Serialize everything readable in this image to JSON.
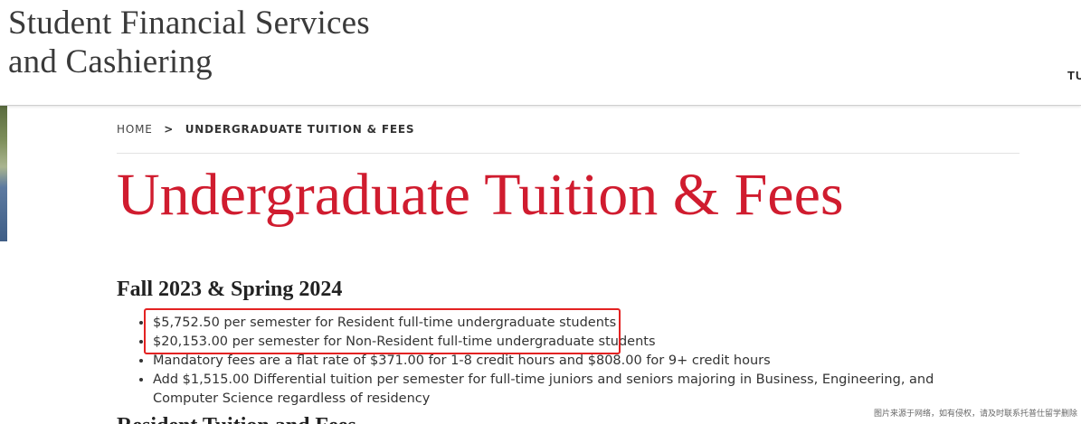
{
  "header": {
    "site_title_line1": "Student Financial Services",
    "site_title_line2": "and Cashiering",
    "nav_fragment": "TU"
  },
  "breadcrumb": {
    "home": "HOME",
    "separator": ">",
    "current": "UNDERGRADUATE TUITION & FEES"
  },
  "main": {
    "title": "Undergraduate Tuition & Fees",
    "section_heading": "Fall 2023 & Spring 2024",
    "items": [
      "$5,752.50 per semester for Resident full-time undergraduate students",
      "$20,153.00 per semester for Non-Resident full-time undergraduate students",
      "Mandatory fees are a flat rate of $371.00 for 1-8 credit hours and $808.00 for 9+ credit hours",
      "Add $1,515.00 Differential tuition per semester for full-time juniors and seniors majoring in Business, Engineering, and Computer Science regardless of residency"
    ],
    "next_section_heading": "Resident Tuition and Fees"
  },
  "watermark": "图片来源于网络，如有侵权，请及时联系托普仕留学删除",
  "colors": {
    "accent_red": "#d01c2f",
    "highlight_box": "#e32222",
    "text": "#333333"
  }
}
